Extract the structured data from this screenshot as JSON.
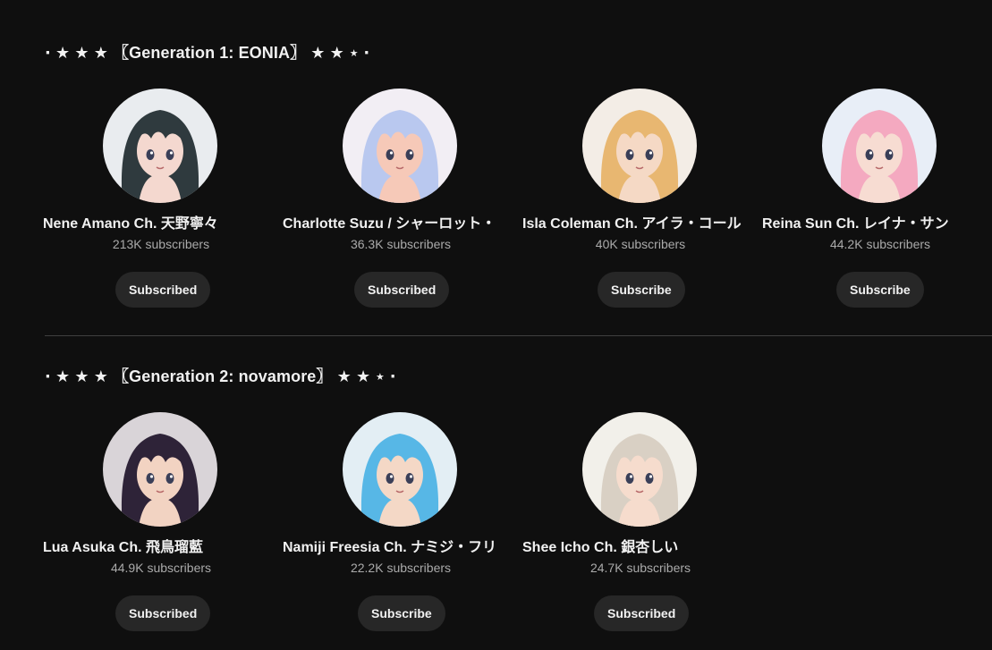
{
  "sections": [
    {
      "title": "⋅ ★ ★ ★ 〖Generation 1: EONIA〗 ★ ★ ⋆ ⋅",
      "channels": [
        {
          "name": "Nene Amano Ch. 天野寧々",
          "subscribers": "213K subscribers",
          "button": "Subscribed",
          "avatar_colors": [
            "#e9ecef",
            "#2f3a3e",
            "#f4d8cf"
          ]
        },
        {
          "name": "Charlotte Suzu / シャーロット・",
          "subscribers": "36.3K subscribers",
          "button": "Subscribed",
          "avatar_colors": [
            "#f2eef4",
            "#b9c8ef",
            "#f6c9b8"
          ]
        },
        {
          "name": "Isla Coleman Ch. アイラ・コール",
          "subscribers": "40K subscribers",
          "button": "Subscribe",
          "avatar_colors": [
            "#f3ede6",
            "#e8b771",
            "#f5d9c5"
          ]
        },
        {
          "name": "Reina Sun Ch. レイナ・サン",
          "subscribers": "44.2K subscribers",
          "button": "Subscribe",
          "avatar_colors": [
            "#e8eef7",
            "#f4a9c0",
            "#f7dcd2"
          ]
        }
      ]
    },
    {
      "title": "⋅ ★ ★ ★ 〖Generation 2: novamore〗 ★ ★ ⋆ ⋅",
      "channels": [
        {
          "name": "Lua Asuka Ch. 飛鳥瑠藍",
          "subscribers": "44.9K subscribers",
          "button": "Subscribed",
          "avatar_colors": [
            "#d9d4d8",
            "#2e2338",
            "#f2d3c2"
          ]
        },
        {
          "name": "Namiji Freesia Ch. ナミジ・フリ",
          "subscribers": "22.2K subscribers",
          "button": "Subscribe",
          "avatar_colors": [
            "#e3eef4",
            "#57b7e6",
            "#f4d8c6"
          ]
        },
        {
          "name": "Shee Icho Ch. 銀杏しい",
          "subscribers": "24.7K subscribers",
          "button": "Subscribed",
          "avatar_colors": [
            "#f2f0ea",
            "#d9d0c4",
            "#f6dccd"
          ]
        }
      ]
    }
  ]
}
